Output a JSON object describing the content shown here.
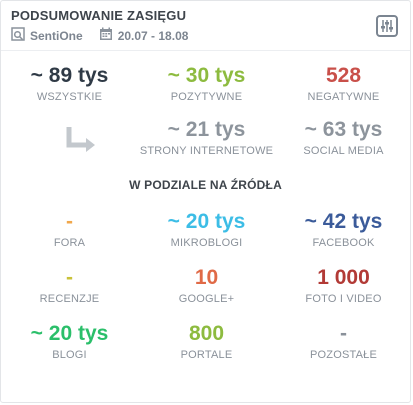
{
  "header": {
    "title": "PODSUMOWANIE ZASIĘGU",
    "source": "SentiOne",
    "date_range": "20.07 - 18.08"
  },
  "totals": {
    "all": {
      "value": "~ 89 tys",
      "label": "WSZYSTKIE",
      "color": "#2f3a46"
    },
    "positive": {
      "value": "~ 30 tys",
      "label": "POZYTYWNE",
      "color": "#8dbb3f"
    },
    "negative": {
      "value": "528",
      "label": "NEGATYWNE",
      "color": "#c9504a"
    }
  },
  "split": {
    "websites": {
      "value": "~ 21 tys",
      "label": "STRONY INTERNETOWE",
      "color": "#8d949c"
    },
    "social": {
      "value": "~ 63 tys",
      "label": "SOCIAL MEDIA",
      "color": "#8d949c"
    }
  },
  "sources_section_title": "W PODZIALE NA ŹRÓDŁA",
  "sources": [
    {
      "value": "-",
      "label": "FORA",
      "color": "#f0a74b"
    },
    {
      "value": "~ 20 tys",
      "label": "MIKROBLOGI",
      "color": "#3cbde6"
    },
    {
      "value": "~ 42 tys",
      "label": "FACEBOOK",
      "color": "#3b5b9a"
    },
    {
      "value": "-",
      "label": "RECENZJE",
      "color": "#c9c238"
    },
    {
      "value": "10",
      "label": "GOOGLE+",
      "color": "#e06a47"
    },
    {
      "value": "1 000",
      "label": "FOTO I VIDEO",
      "color": "#b23a36"
    },
    {
      "value": "~ 20 tys",
      "label": "BLOGI",
      "color": "#2bbf6a"
    },
    {
      "value": "800",
      "label": "PORTALE",
      "color": "#8dbb3f"
    },
    {
      "value": "-",
      "label": "POZOSTAŁE",
      "color": "#8a919a"
    }
  ],
  "icons": {
    "source": "sentione-icon",
    "calendar": "calendar-icon",
    "settings": "sliders-icon",
    "arrow": "arrow-down-right-icon"
  },
  "colors": {
    "header_text": "#3e444b",
    "meta_text": "#7d8590",
    "border": "#e3e5e8"
  }
}
